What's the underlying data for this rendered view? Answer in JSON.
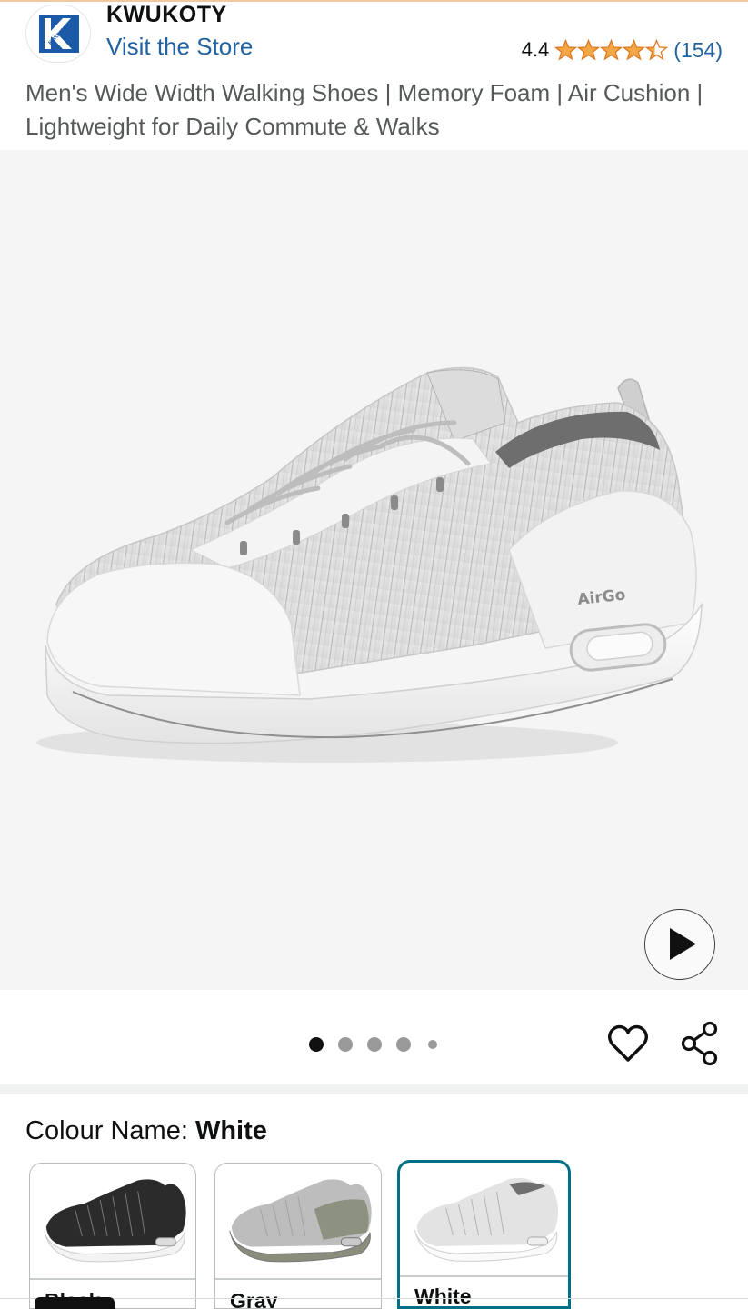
{
  "brand": {
    "name": "KWUKOTY",
    "logo_text": "KWUKOTY",
    "visit_store": "Visit the Store"
  },
  "rating": {
    "value": "4.4",
    "count": "(154)",
    "stars_filled": 4.4,
    "star_color": "#f3a847"
  },
  "product": {
    "title": "Men's Wide Width Walking Shoes | Memory Foam | Air Cushion | Lightweight for Daily Commute & Walks",
    "shoe_badge_text": "AirGo"
  },
  "gallery": {
    "image_count": 5,
    "active_index": 0,
    "play_icon": "play-icon",
    "wishlist_icon": "heart-icon",
    "share_icon": "share-icon"
  },
  "colour": {
    "label": "Colour Name: ",
    "selected": "White",
    "options": [
      {
        "label": "Black"
      },
      {
        "label": "Gray"
      },
      {
        "label": "White"
      }
    ]
  },
  "colors": {
    "link": "#2162a1",
    "selected_border": "#007185",
    "gallery_bg": "#f5f5f5"
  }
}
